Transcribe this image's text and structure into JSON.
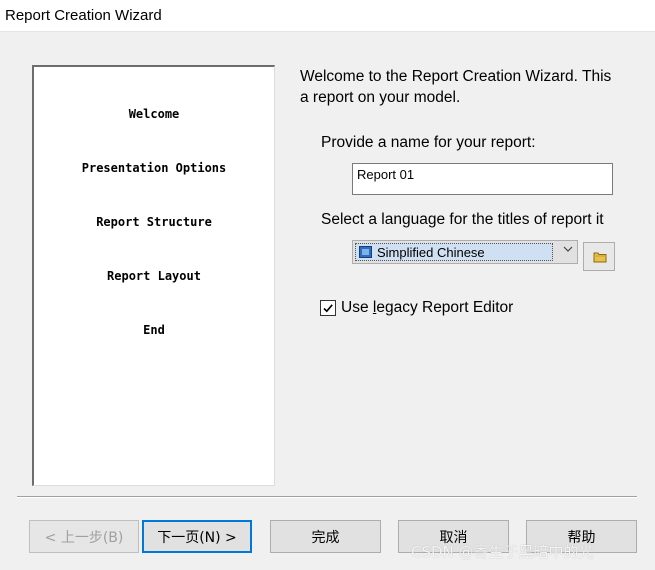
{
  "window": {
    "title": "Report Creation Wizard"
  },
  "steps": [
    {
      "label": "Welcome"
    },
    {
      "label": "Presentation Options"
    },
    {
      "label": "Report Structure"
    },
    {
      "label": "Report Layout"
    },
    {
      "label": "End"
    }
  ],
  "intro": {
    "line1": "Welcome to the Report Creation Wizard. This",
    "line2": "a report on your model."
  },
  "name_field": {
    "label": "Provide a name for your report:",
    "value": "Report 01"
  },
  "language": {
    "label": "Select a language for the titles of report it",
    "selected": "Simplified Chinese",
    "icon": "flag-icon"
  },
  "browse_button": {
    "icon": "folder-icon"
  },
  "legacy_editor": {
    "checked": true,
    "label_before": "Use ",
    "label_underlined": "l",
    "label_after": "egacy Report Editor"
  },
  "buttons": {
    "back": "< 上一步(B)",
    "next": "下一页(N) >",
    "finish": "完成",
    "cancel": "取消",
    "help": "帮助"
  },
  "watermark": "CSDN @寄生于黑暗中的光"
}
